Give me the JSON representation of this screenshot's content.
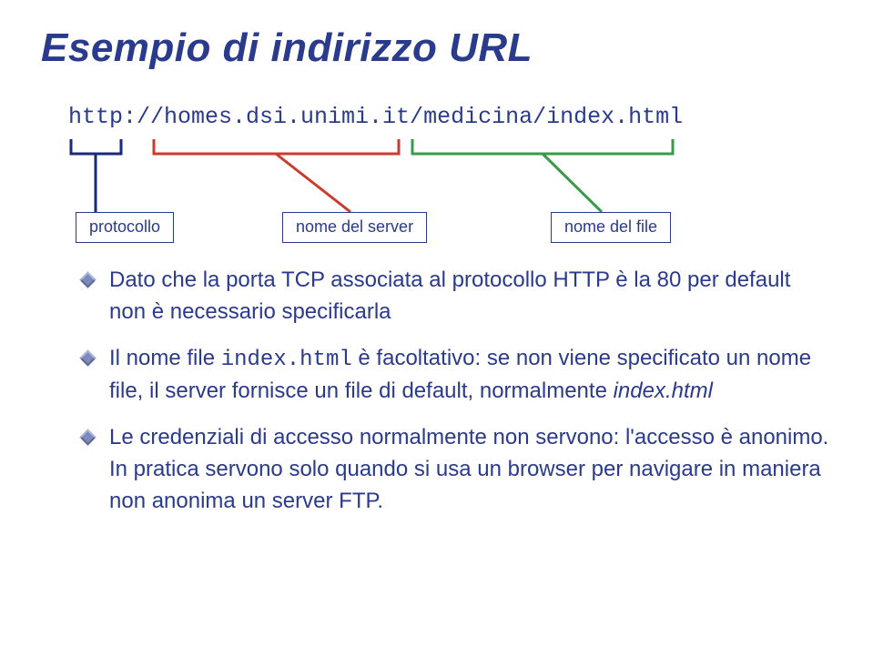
{
  "title": "Esempio di indirizzo URL",
  "url": "http://homes.dsi.unimi.it/medicina/index.html",
  "labels": {
    "protocollo": "protocollo",
    "server": "nome del server",
    "file": "nome del file"
  },
  "bullets": [
    {
      "pre": "Dato che la porta TCP associata al protocollo HTTP è la 80 per default non è necessario specificarla"
    },
    {
      "pre": "Il nome file ",
      "code": "index.html",
      "mid": " è facoltativo: se non viene specificato un nome file, il server fornisce un file di default, normalmente ",
      "ital": "index.html"
    },
    {
      "pre": "Le credenziali di accesso normalmente non servono: l'accesso è anonimo. In pratica servono solo quando si usa un browser per navigare in maniera non anonima un server FTP."
    }
  ],
  "colors": {
    "protocollo_line": "#1a2a7a",
    "server_line": "#cc3b2e",
    "file_line": "#3a9a4a"
  }
}
